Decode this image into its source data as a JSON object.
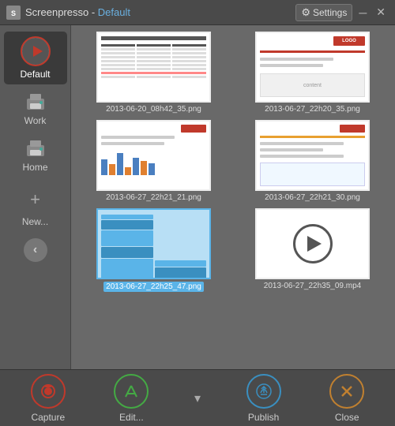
{
  "titleBar": {
    "icon": "SP",
    "appName": "Screenpresso",
    "separator": " - ",
    "profileName": "Default",
    "settingsLabel": "Settings",
    "minimizeLabel": "─",
    "closeLabel": "✕"
  },
  "sidebar": {
    "items": [
      {
        "id": "default",
        "label": "Default",
        "type": "profile",
        "active": true
      },
      {
        "id": "work",
        "label": "Work",
        "type": "printer"
      },
      {
        "id": "home",
        "label": "Home",
        "type": "printer"
      },
      {
        "id": "new",
        "label": "New...",
        "type": "add"
      }
    ],
    "backButton": "‹"
  },
  "grid": {
    "items": [
      {
        "id": "img1",
        "label": "2013-06-20_08h42_35.png",
        "type": "table",
        "selected": false
      },
      {
        "id": "img2",
        "label": "2013-06-27_22h20_35.png",
        "type": "brand-red",
        "selected": false
      },
      {
        "id": "img3",
        "label": "2013-06-27_22h21_21.png",
        "type": "bars",
        "selected": false
      },
      {
        "id": "img4",
        "label": "2013-06-27_22h21_30.png",
        "type": "lines",
        "selected": false
      },
      {
        "id": "img5",
        "label": "2013-06-27_22h25_47.png",
        "type": "blue-chart",
        "selected": true
      },
      {
        "id": "img6",
        "label": "2013-06-27_22h35_09.mp4",
        "type": "video",
        "selected": false
      }
    ]
  },
  "bottomBar": {
    "capture": "Capture",
    "edit": "Edit...",
    "publish": "Publish",
    "close": "Close",
    "dropdownSymbol": "▾"
  }
}
